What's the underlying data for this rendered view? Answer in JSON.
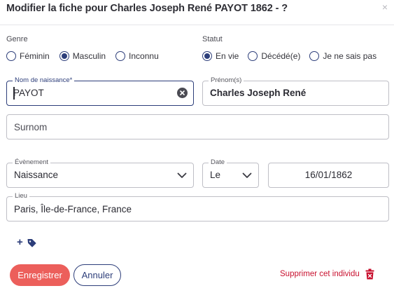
{
  "dialog": {
    "title": "Modifier la fiche pour Charles Joseph René PAYOT 1862 - ?",
    "close_glyph": "×"
  },
  "genre": {
    "label": "Genre",
    "options": [
      {
        "label": "Féminin",
        "selected": false
      },
      {
        "label": "Masculin",
        "selected": true
      },
      {
        "label": "Inconnu",
        "selected": false
      }
    ]
  },
  "statut": {
    "label": "Statut",
    "options": [
      {
        "label": "En vie",
        "selected": true
      },
      {
        "label": "Décédé(e)",
        "selected": false
      },
      {
        "label": "Je ne sais pas",
        "selected": false
      }
    ]
  },
  "nom": {
    "label": "Nom de naissance*",
    "value": "PAYOT"
  },
  "prenom": {
    "label": "Prénom(s)",
    "value": "Charles Joseph René"
  },
  "surnom": {
    "placeholder": "Surnom"
  },
  "evenement": {
    "label": "Évènement",
    "value": "Naissance"
  },
  "date": {
    "label": "Date",
    "qualifier": "Le",
    "value": "16/01/1862"
  },
  "lieu": {
    "label": "Lieu",
    "value": "Paris, Île-de-France, France"
  },
  "tags": {
    "plus_glyph": "+"
  },
  "actions": {
    "save_label": "Enregistrer",
    "cancel_label": "Annuler",
    "delete_label": "Supprimer cet individu"
  },
  "colors": {
    "primary": "#2d3e7a",
    "save": "#ec5f5b",
    "danger": "#c8102e",
    "border": "#bfbfc6"
  },
  "icons": [
    "close-icon",
    "clear-icon",
    "chevron-down-icon",
    "plus-icon",
    "tag-icon",
    "trash-icon"
  ]
}
